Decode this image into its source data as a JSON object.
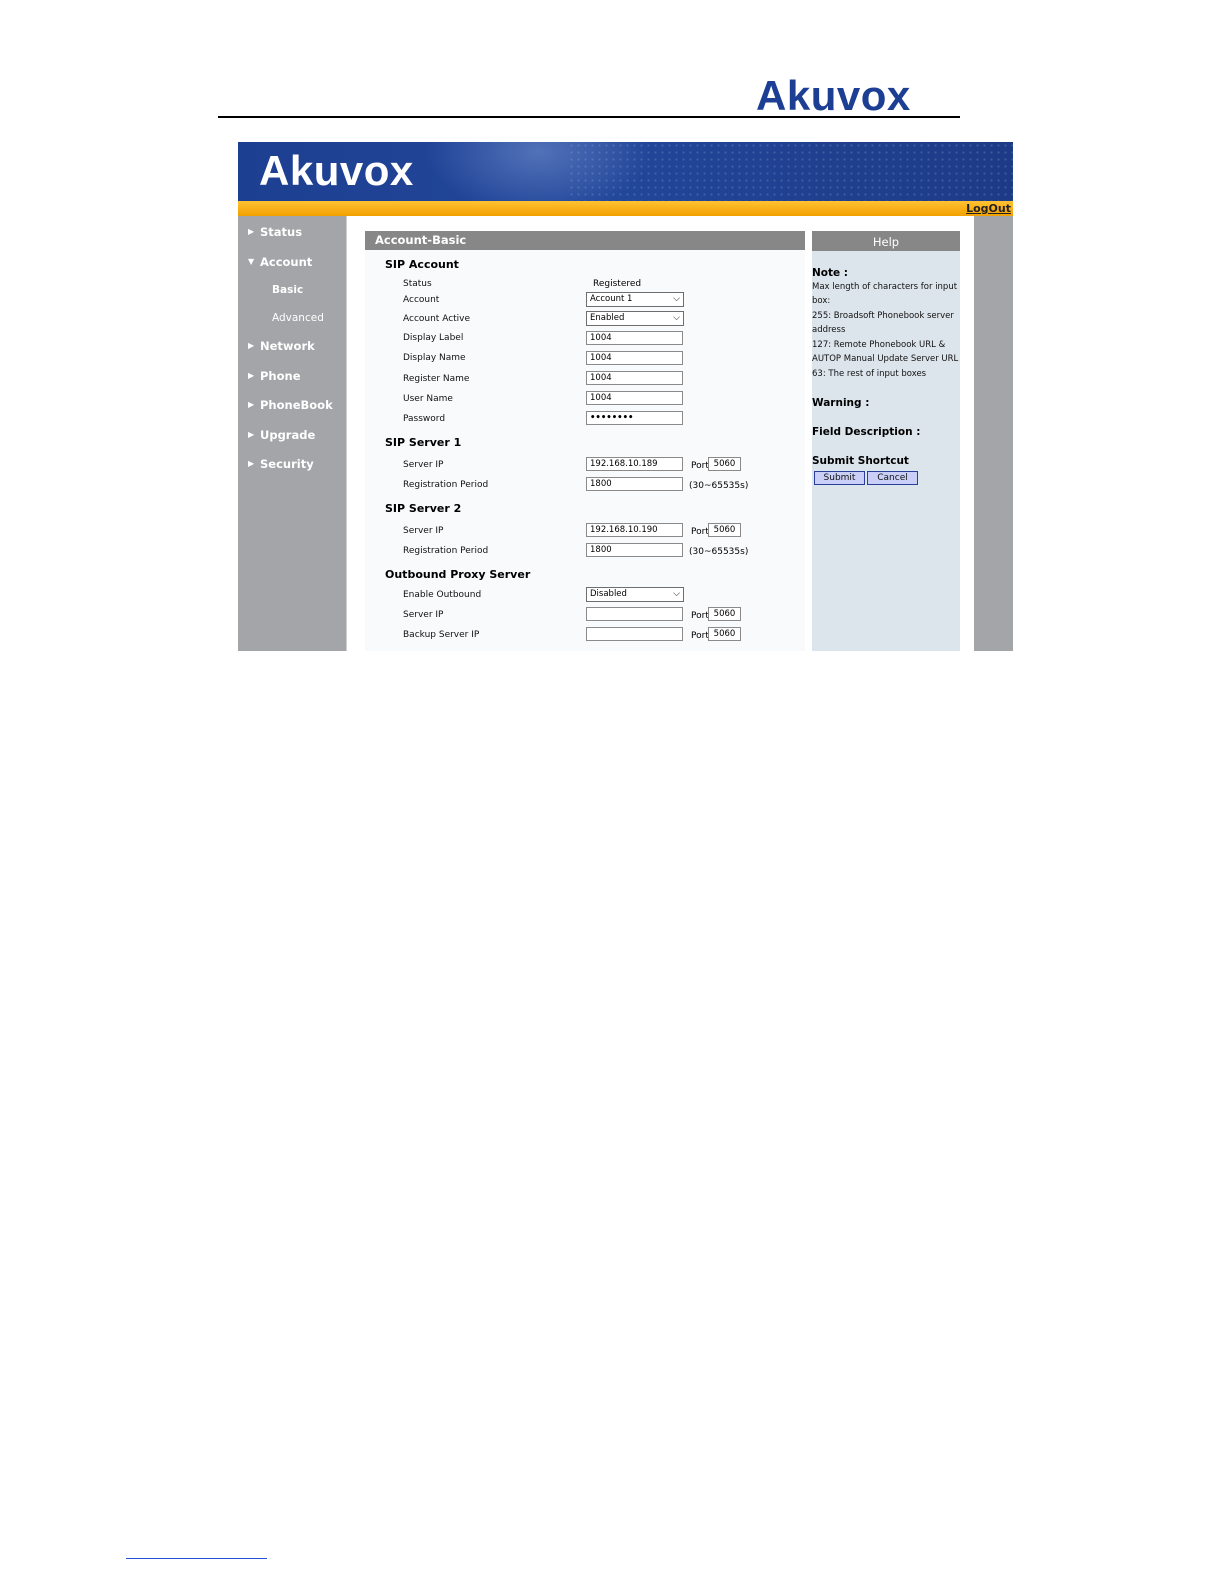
{
  "document": {
    "logo_text": "Akuvox"
  },
  "banner": {
    "logo_text": "Akuvox",
    "logout_label": "LogOut"
  },
  "sidebar": {
    "items": [
      {
        "label": "Status"
      },
      {
        "label": "Account"
      },
      {
        "label": "Basic"
      },
      {
        "label": "Advanced"
      },
      {
        "label": "Network"
      },
      {
        "label": "Phone"
      },
      {
        "label": "PhoneBook"
      },
      {
        "label": "Upgrade"
      },
      {
        "label": "Security"
      }
    ]
  },
  "main": {
    "title": "Account-Basic",
    "sip_account": {
      "heading": "SIP Account",
      "status_label": "Status",
      "status_value": "Registered",
      "account_label": "Account",
      "account_value": "Account 1",
      "active_label": "Account Active",
      "active_value": "Enabled",
      "display_label_label": "Display Label",
      "display_label_value": "1004",
      "display_name_label": "Display Name",
      "display_name_value": "1004",
      "register_name_label": "Register Name",
      "register_name_value": "1004",
      "user_name_label": "User Name",
      "user_name_value": "1004",
      "password_label": "Password",
      "password_value": "••••••••"
    },
    "sip_server_1": {
      "heading": "SIP Server 1",
      "server_ip_label": "Server IP",
      "server_ip_value": "192.168.10.189",
      "port_label": "Port",
      "port_value": "5060",
      "reg_period_label": "Registration Period",
      "reg_period_value": "1800",
      "reg_period_range": "(30~65535s)"
    },
    "sip_server_2": {
      "heading": "SIP Server 2",
      "server_ip_label": "Server IP",
      "server_ip_value": "192.168.10.190",
      "port_label": "Port",
      "port_value": "5060",
      "reg_period_label": "Registration Period",
      "reg_period_value": "1800",
      "reg_period_range": "(30~65535s)"
    },
    "outbound": {
      "heading": "Outbound Proxy Server",
      "enable_label": "Enable Outbound",
      "enable_value": "Disabled",
      "server_ip_label": "Server IP",
      "server_ip_value": "",
      "port_label": "Port",
      "port_value": "5060",
      "backup_ip_label": "Backup Server IP",
      "backup_ip_value": "",
      "backup_port_label": "Port",
      "backup_port_value": "5060"
    }
  },
  "help": {
    "title": "Help",
    "note_heading": "Note :",
    "note_lines": [
      "Max length of characters for input",
      "box:",
      "255: Broadsoft Phonebook server",
      "address",
      "127: Remote Phonebook URL &",
      "AUTOP Manual Update Server URL",
      "63: The rest of input boxes"
    ],
    "warning_heading": "Warning :",
    "field_desc_heading": "Field Description :",
    "shortcut_heading": "Submit Shortcut",
    "submit_label": "Submit",
    "cancel_label": "Cancel"
  },
  "colors": {
    "brand_blue": "#1c3f94",
    "accent_orange": "#f7b000",
    "sidebar_gray": "#a4a5a8"
  }
}
